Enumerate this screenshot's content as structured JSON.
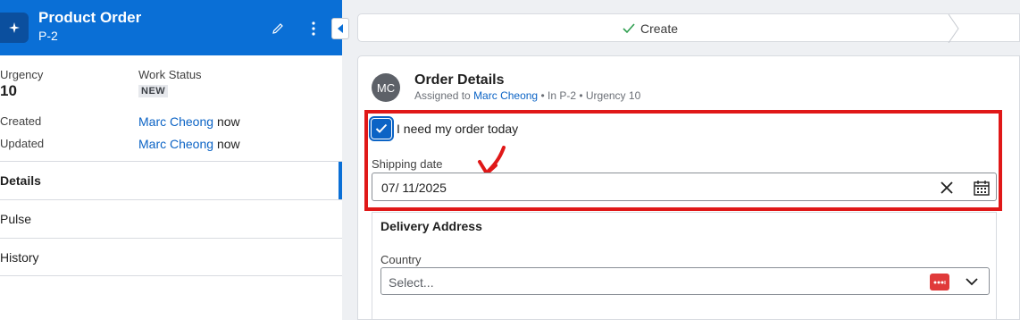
{
  "record": {
    "title": "Product Order",
    "id": "P-2"
  },
  "fields": {
    "urgency_label": "Urgency",
    "urgency_value": "10",
    "status_label": "Work Status",
    "status_value": "NEW",
    "created_label": "Created",
    "created_by": "Marc Cheong",
    "created_when": "now",
    "updated_label": "Updated",
    "updated_by": "Marc Cheong",
    "updated_when": "now"
  },
  "nav": {
    "items": [
      {
        "label": "Details"
      },
      {
        "label": "Pulse"
      },
      {
        "label": "History"
      }
    ]
  },
  "stage": {
    "label": "Create"
  },
  "card": {
    "avatar": "MC",
    "title": "Order Details",
    "assigned_prefix": "Assigned to",
    "assigned_to": "Marc Cheong",
    "meta": "• In P-2 • Urgency 10",
    "checkbox_label": "I need my order today",
    "checkbox_checked": true,
    "shipping_label": "Shipping date",
    "shipping_value": "07/ 11/2025",
    "address_title": "Delivery Address",
    "country_label": "Country",
    "country_placeholder": "Select..."
  },
  "colors": {
    "header_blue": "#0a6fd6",
    "link_blue": "#0b63c5",
    "highlight_red": "#e01818"
  }
}
